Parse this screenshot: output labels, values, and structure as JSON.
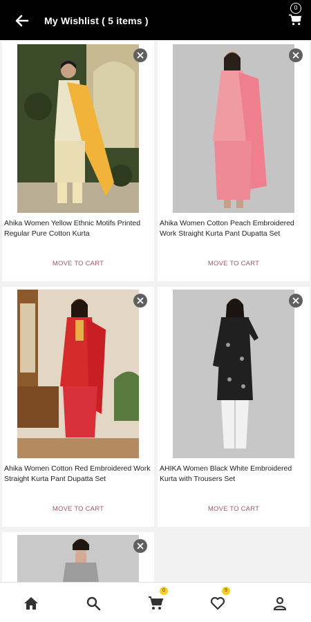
{
  "header": {
    "title": "My Wishlist ( 5 items )",
    "cart_count": "0"
  },
  "products": [
    {
      "name": "Ahika Women Yellow Ethnic Motifs Printed Regular Pure Cotton Kurta",
      "action": "MOVE TO CART"
    },
    {
      "name": "Ahika Women Cotton Peach Embroidered Work Straight Kurta Pant Dupatta Set",
      "action": "MOVE TO CART"
    },
    {
      "name": "Ahika Women Cotton Red Embroidered Work Straight Kurta Pant Dupatta Set",
      "action": "MOVE TO CART"
    },
    {
      "name": "AHIKA Women Black White Embroidered Kurta with Trousers Set",
      "action": "MOVE TO CART"
    },
    {
      "name": "",
      "action": ""
    }
  ],
  "bottom_nav": {
    "items": [
      "home-icon",
      "search-icon",
      "cart-icon",
      "heart-icon",
      "user-icon"
    ],
    "cart_badge": "0",
    "wishlist_badge": "5"
  },
  "colors": {
    "header_bg": "#000000",
    "accent_text": "#a2577a",
    "badge": "#f5cf21"
  }
}
